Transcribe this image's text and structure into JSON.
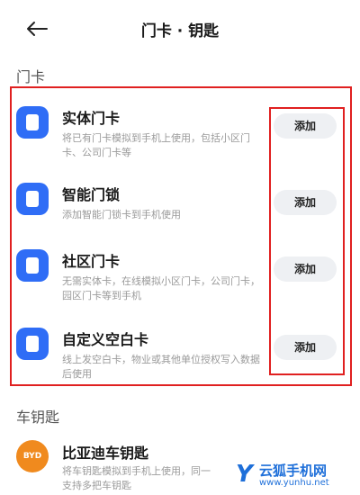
{
  "header": {
    "title": "门卡 · 钥匙"
  },
  "sections": {
    "door_cards": "门卡",
    "car_keys": "车钥匙"
  },
  "door_cards": [
    {
      "name": "实体门卡",
      "desc": "将已有门卡模拟到手机上使用，包括小区门卡、公司门卡等",
      "button": "添加"
    },
    {
      "name": "智能门锁",
      "desc": "添加智能门锁卡到手机使用",
      "button": "添加"
    },
    {
      "name": "社区门卡",
      "desc": "无需实体卡，在线模拟小区门卡，公司门卡，园区门卡等到手机",
      "button": "添加"
    },
    {
      "name": "自定义空白卡",
      "desc": "线上发空白卡，物业或其他单位授权写入数据后使用",
      "button": "添加"
    }
  ],
  "car_key": {
    "brand_logo": "BYD",
    "name": "比亚迪车钥匙",
    "desc": "将车钥匙模拟到手机上使用，同一\n支持多把车钥匙"
  },
  "watermark": {
    "mark": "Y",
    "text": "云狐手机网",
    "url": "www.yunhu.net"
  },
  "colors": {
    "accent": "#2f6df6",
    "highlight_box": "#e02020",
    "byd": "#f08a1e",
    "watermark": "#1e6fd9"
  }
}
